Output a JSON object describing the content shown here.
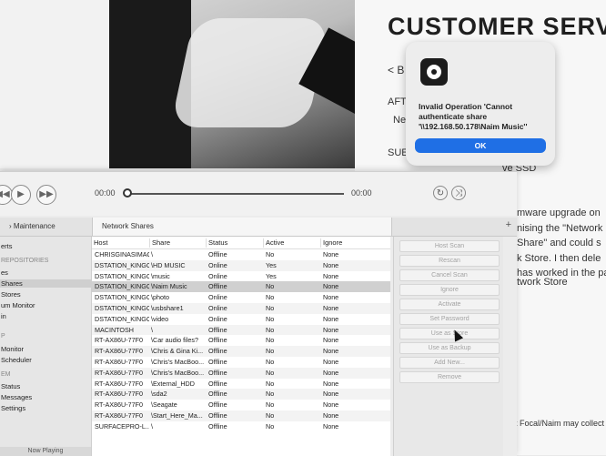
{
  "site": {
    "title": "CUSTOMER SERV",
    "back_link": "< B",
    "aft_text": "AFT",
    "ne_text": "Ne",
    "sub_text": "SUE",
    "ssd_text": "ve SSD",
    "body_lines": [
      "mware upgrade on",
      "nising the \"Network",
      "Share\" and could s",
      "k Store. I then dele",
      "has worked in the pa",
      "twork Store"
    ],
    "footer_text": "t Focal/Naim may collect th"
  },
  "dialog": {
    "message": "Invalid Operation 'Cannot authenticate share '\\\\192.168.50.178\\Naim Music''",
    "ok_label": "OK",
    "accent_color": "#1f6fe5"
  },
  "transport": {
    "time_start": "00:00",
    "time_end": "00:00"
  },
  "tabs": [
    {
      "label": "Maintenance"
    },
    {
      "label": "Network Shares"
    }
  ],
  "sidebar": {
    "items": [
      {
        "label": "erts",
        "type": "item"
      },
      {
        "label": "REPOSITORIES",
        "type": "header"
      },
      {
        "label": "es",
        "type": "item"
      },
      {
        "label": "Shares",
        "type": "selected"
      },
      {
        "label": "Stores",
        "type": "item"
      },
      {
        "label": "um Monitor",
        "type": "item"
      },
      {
        "label": "in",
        "type": "item"
      },
      {
        "label": "P",
        "type": "header"
      },
      {
        "label": "Monitor",
        "type": "item"
      },
      {
        "label": "Scheduler",
        "type": "item"
      },
      {
        "label": "EM",
        "type": "header"
      },
      {
        "label": "Status",
        "type": "item"
      },
      {
        "label": "Messages",
        "type": "item"
      },
      {
        "label": "Settings",
        "type": "item"
      }
    ],
    "now_playing": "Now Playing"
  },
  "table": {
    "columns": [
      "Host",
      "Share",
      "Status",
      "Active",
      "Ignore"
    ],
    "rows": [
      {
        "host": "CHRISGINASIMAC",
        "share": "\\",
        "status": "Offline",
        "active": "No",
        "ignore": "None"
      },
      {
        "host": "DSTATION_KINGC",
        "share": "\\HD MUSIC",
        "status": "Online",
        "active": "Yes",
        "ignore": "None"
      },
      {
        "host": "DSTATION_KINGC",
        "share": "\\music",
        "status": "Online",
        "active": "Yes",
        "ignore": "None"
      },
      {
        "host": "DSTATION_KINGC",
        "share": "\\Naim Music",
        "status": "Offline",
        "active": "No",
        "ignore": "None"
      },
      {
        "host": "DSTATION_KINGC",
        "share": "\\photo",
        "status": "Online",
        "active": "No",
        "ignore": "None"
      },
      {
        "host": "DSTATION_KINGC",
        "share": "\\usbshare1",
        "status": "Online",
        "active": "No",
        "ignore": "None"
      },
      {
        "host": "DSTATION_KINGC",
        "share": "\\video",
        "status": "Online",
        "active": "No",
        "ignore": "None"
      },
      {
        "host": "MACINTOSH",
        "share": "\\",
        "status": "Offline",
        "active": "No",
        "ignore": "None"
      },
      {
        "host": "RT-AX86U-77F0",
        "share": "\\Car audio files?",
        "status": "Offline",
        "active": "No",
        "ignore": "None"
      },
      {
        "host": "RT-AX86U-77F0",
        "share": "\\Chris & Gina Ki...",
        "status": "Offline",
        "active": "No",
        "ignore": "None"
      },
      {
        "host": "RT-AX86U-77F0",
        "share": "\\Chris's MacBoo...",
        "status": "Offline",
        "active": "No",
        "ignore": "None"
      },
      {
        "host": "RT-AX86U-77F0",
        "share": "\\Chris's MacBoo...",
        "status": "Offline",
        "active": "No",
        "ignore": "None"
      },
      {
        "host": "RT-AX86U-77F0",
        "share": "\\External_HDD",
        "status": "Offline",
        "active": "No",
        "ignore": "None"
      },
      {
        "host": "RT-AX86U-77F0",
        "share": "\\sda2",
        "status": "Offline",
        "active": "No",
        "ignore": "None"
      },
      {
        "host": "RT-AX86U-77F0",
        "share": "\\Seagate",
        "status": "Offline",
        "active": "No",
        "ignore": "None"
      },
      {
        "host": "RT-AX86U-77F0",
        "share": "\\Start_Here_Ma...",
        "status": "Offline",
        "active": "No",
        "ignore": "None"
      },
      {
        "host": "SURFACEPRO-L...",
        "share": "\\",
        "status": "Offline",
        "active": "No",
        "ignore": "None"
      }
    ],
    "selected_row": 3
  },
  "actions": [
    "Host Scan",
    "Rescan",
    "Cancel Scan",
    "Ignore",
    "Activate",
    "Set Password",
    "Use as Store",
    "Use as Backup",
    "Add New...",
    "Remove"
  ]
}
